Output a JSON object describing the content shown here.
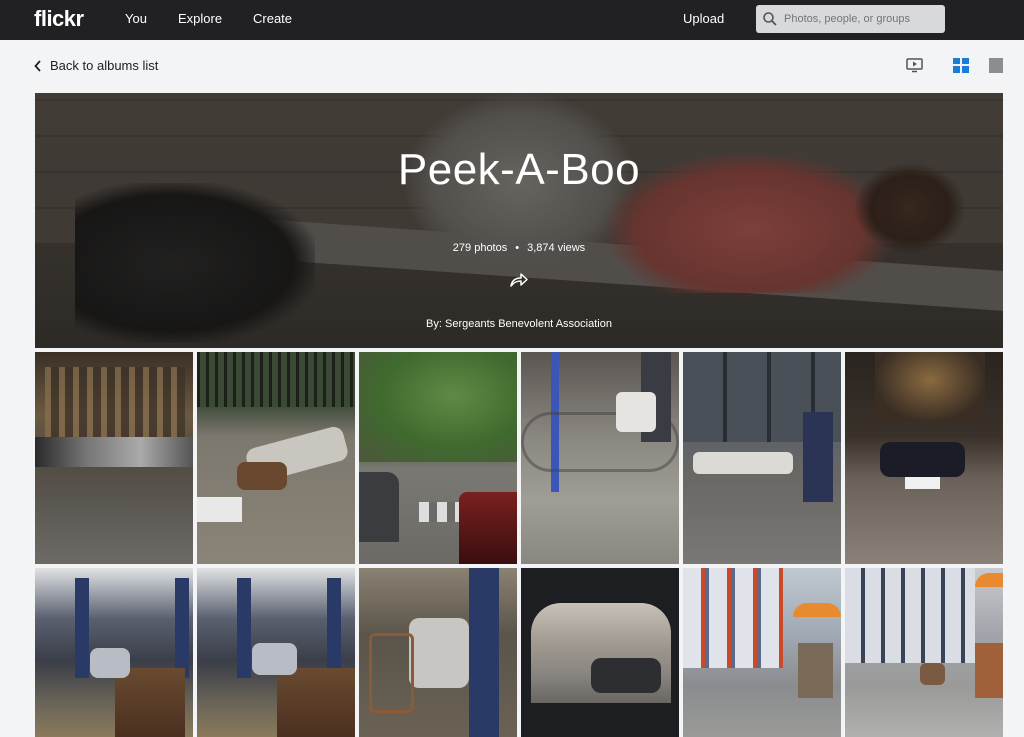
{
  "topbar": {
    "logo": "flickr",
    "nav": [
      "You",
      "Explore",
      "Create"
    ],
    "upload": "Upload",
    "search_placeholder": "Photos, people, or groups"
  },
  "subbar": {
    "back_label": "Back to albums list"
  },
  "album": {
    "title": "Peek-A-Boo",
    "photos": "279 photos",
    "views": "3,874 views",
    "byline": "By: Sergeants Benevolent Association"
  },
  "icons": [
    "search-icon",
    "chevron-left-icon",
    "slideshow-icon",
    "grid-view-icon",
    "single-view-icon",
    "share-icon"
  ],
  "colors": {
    "topbar": "#212124",
    "page_bg": "#f2f4f6",
    "grid_icon_active": "#1c7cd5"
  },
  "photos": [
    {
      "name": "photo-street-night"
    },
    {
      "name": "photo-sidewalk-sleeper"
    },
    {
      "name": "photo-crosswalk"
    },
    {
      "name": "photo-bike-rack"
    },
    {
      "name": "photo-storefront-sleeper"
    },
    {
      "name": "photo-cafe-corner"
    },
    {
      "name": "photo-subway-platform-1"
    },
    {
      "name": "photo-subway-platform-2"
    },
    {
      "name": "photo-subway-cart"
    },
    {
      "name": "photo-car-window"
    },
    {
      "name": "photo-street-vendor-1"
    },
    {
      "name": "photo-street-vendor-2"
    }
  ]
}
